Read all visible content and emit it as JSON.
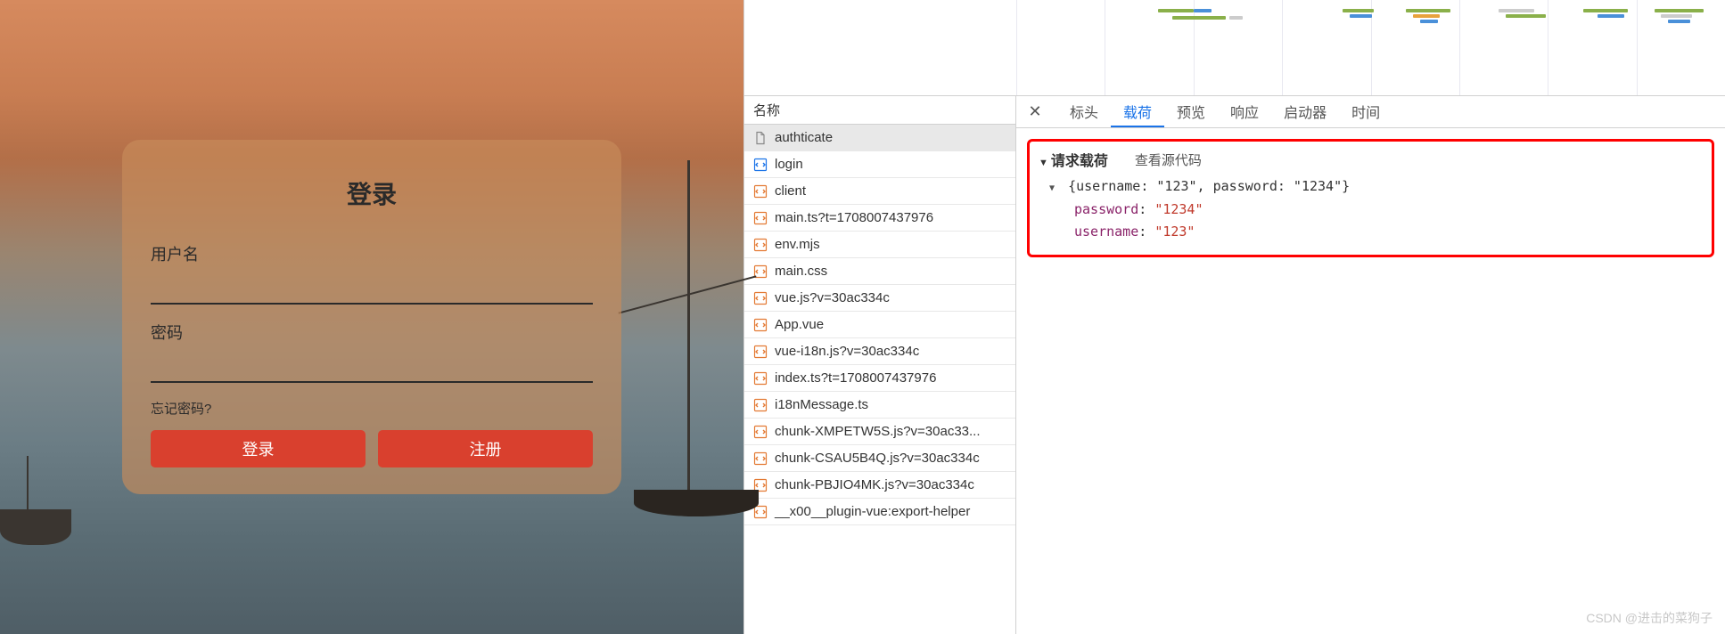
{
  "login": {
    "title": "登录",
    "username_label": "用户名",
    "password_label": "密码",
    "forgot": "忘记密码?",
    "login_btn": "登录",
    "register_btn": "注册"
  },
  "network": {
    "header": "名称",
    "requests": [
      {
        "name": "authticate",
        "type": "doc"
      },
      {
        "name": "login",
        "type": "html"
      },
      {
        "name": "client",
        "type": "js"
      },
      {
        "name": "main.ts?t=1708007437976",
        "type": "js"
      },
      {
        "name": "env.mjs",
        "type": "js"
      },
      {
        "name": "main.css",
        "type": "js"
      },
      {
        "name": "vue.js?v=30ac334c",
        "type": "js"
      },
      {
        "name": "App.vue",
        "type": "js"
      },
      {
        "name": "vue-i18n.js?v=30ac334c",
        "type": "js"
      },
      {
        "name": "index.ts?t=1708007437976",
        "type": "js"
      },
      {
        "name": "i18nMessage.ts",
        "type": "js"
      },
      {
        "name": "chunk-XMPETW5S.js?v=30ac33...",
        "type": "js"
      },
      {
        "name": "chunk-CSAU5B4Q.js?v=30ac334c",
        "type": "js"
      },
      {
        "name": "chunk-PBJIO4MK.js?v=30ac334c",
        "type": "js"
      },
      {
        "name": "__x00__plugin-vue:export-helper",
        "type": "js"
      }
    ]
  },
  "detail": {
    "tabs": [
      "标头",
      "载荷",
      "预览",
      "响应",
      "启动器",
      "时间"
    ],
    "active_tab": "载荷",
    "payload_title": "请求载荷",
    "view_source": "查看源代码",
    "summary": "{username: \"123\", password: \"1234\"}",
    "props": [
      {
        "key": "password",
        "value": "\"1234\""
      },
      {
        "key": "username",
        "value": "\"123\""
      }
    ]
  },
  "watermark": "CSDN @进击的菜狗子"
}
